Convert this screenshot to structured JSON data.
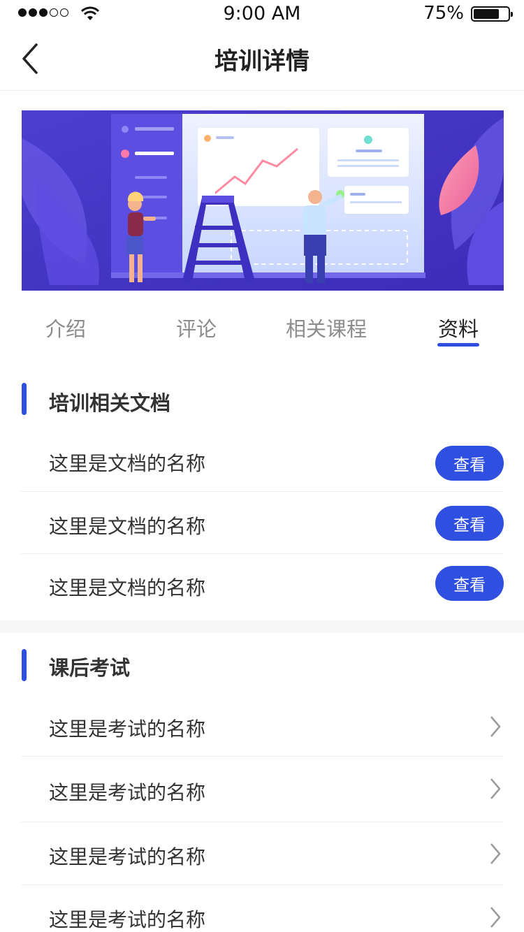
{
  "status_bar": {
    "time": "9:00 AM",
    "battery": "75%",
    "battery_level": 0.75
  },
  "nav": {
    "title": "培训详情"
  },
  "tabs": [
    {
      "label": "介绍"
    },
    {
      "label": "评论"
    },
    {
      "label": "相关课程"
    },
    {
      "label": "资料"
    }
  ],
  "docs_section": {
    "title": "培训相关文档",
    "items": [
      {
        "name": "这里是文档的名称",
        "button": "查看"
      },
      {
        "name": "这里是文档的名称",
        "button": "查看"
      },
      {
        "name": "这里是文档的名称",
        "button": "查看"
      }
    ]
  },
  "exam_section": {
    "title": "课后考试",
    "items": [
      {
        "name": "这里是考试的名称"
      },
      {
        "name": "这里是考试的名称"
      },
      {
        "name": "这里是考试的名称"
      },
      {
        "name": "这里是考试的名称"
      }
    ]
  },
  "colors": {
    "accent": "#2f4fe0",
    "banner_bg": "#4a3fcf"
  }
}
